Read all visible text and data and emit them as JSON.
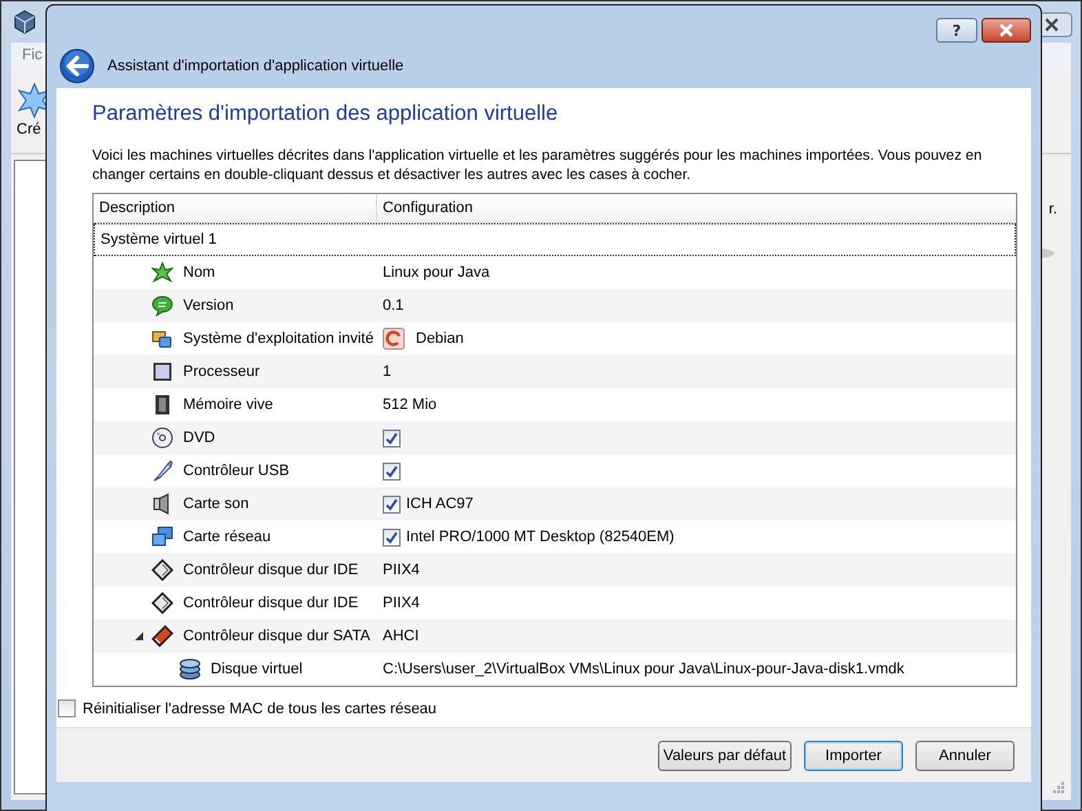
{
  "main_window": {
    "menu_text": "Fic",
    "toolbar_label": "Cré",
    "side_text": "r."
  },
  "dialog": {
    "help_label": "?",
    "title": "Assistant d'importation d'application virtuelle",
    "heading": "Paramètres d'importation des application virtuelle",
    "description": "Voici les machines virtuelles décrites dans l'application virtuelle et les paramètres suggérés pour les machines importées. Vous pouvez en changer certains en double-cliquant dessus et désactiver les autres avec les cases à cocher.",
    "table": {
      "columns": [
        "Description",
        "Configuration"
      ],
      "rows": [
        {
          "kind": "group",
          "description": "Système virtuel 1",
          "focused": true,
          "children": [
            {
              "kind": "name",
              "description": "Nom",
              "value": "Linux pour Java"
            },
            {
              "kind": "version",
              "description": "Version",
              "value": "0.1"
            },
            {
              "kind": "os",
              "description": "Système d'exploitation invité",
              "value": "Debian"
            },
            {
              "kind": "cpu",
              "description": "Processeur",
              "value": "1"
            },
            {
              "kind": "memory",
              "description": "Mémoire vive",
              "value": "512 Mio"
            },
            {
              "kind": "dvd",
              "description": "DVD",
              "checked": true
            },
            {
              "kind": "usb",
              "description": "Contrôleur USB",
              "checked": true
            },
            {
              "kind": "sound",
              "description": "Carte son",
              "checked": true,
              "value": "ICH AC97"
            },
            {
              "kind": "network",
              "description": "Carte réseau",
              "checked": true,
              "value": "Intel PRO/1000 MT Desktop (82540EM)"
            },
            {
              "kind": "ide",
              "description": "Contrôleur disque dur IDE",
              "value": "PIIX4"
            },
            {
              "kind": "ide",
              "description": "Contrôleur disque dur IDE",
              "value": "PIIX4"
            },
            {
              "kind": "sata",
              "description": "Contrôleur disque dur SATA",
              "value": "AHCI",
              "expanded": true,
              "children": [
                {
                  "kind": "disk",
                  "description": "Disque virtuel",
                  "value": "C:\\Users\\user_2\\VirtualBox VMs\\Linux pour Java\\Linux-pour-Java-disk1.vmdk"
                }
              ]
            }
          ]
        }
      ]
    },
    "reset_mac": {
      "label": "Réinitialiser l'adresse MAC de tous les cartes réseau",
      "checked": false
    },
    "buttons": [
      {
        "label": "Valeurs par défaut",
        "default": false
      },
      {
        "label": "Importer",
        "default": true
      },
      {
        "label": "Annuler",
        "default": false
      }
    ]
  }
}
